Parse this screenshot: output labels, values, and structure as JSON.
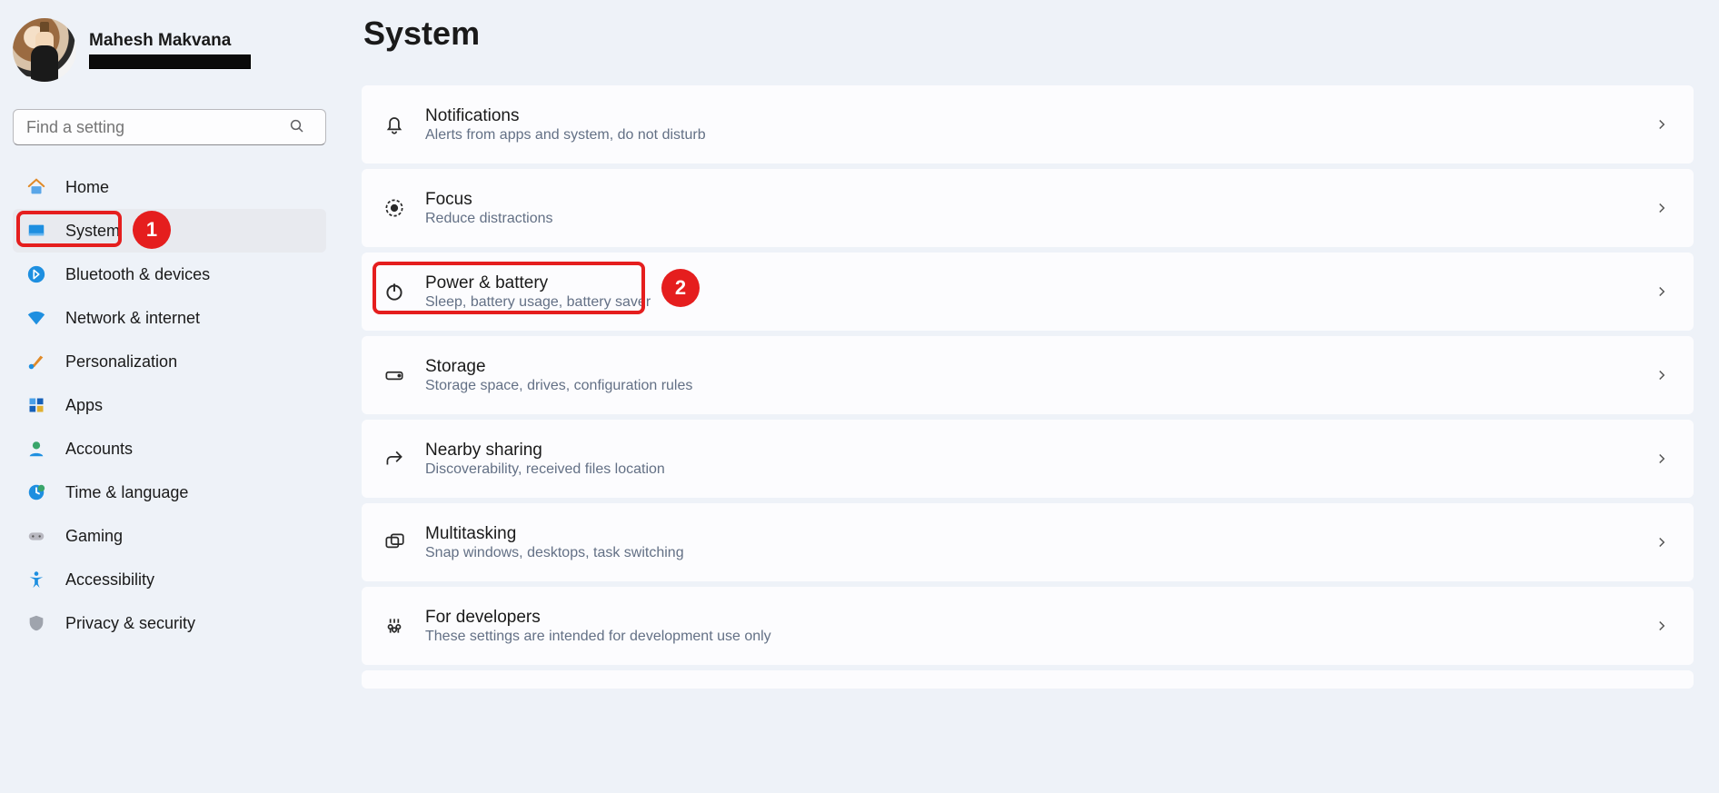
{
  "profile": {
    "name": "Mahesh Makvana"
  },
  "search": {
    "placeholder": "Find a setting"
  },
  "nav": {
    "items": [
      {
        "label": "Home"
      },
      {
        "label": "System"
      },
      {
        "label": "Bluetooth & devices"
      },
      {
        "label": "Network & internet"
      },
      {
        "label": "Personalization"
      },
      {
        "label": "Apps"
      },
      {
        "label": "Accounts"
      },
      {
        "label": "Time & language"
      },
      {
        "label": "Gaming"
      },
      {
        "label": "Accessibility"
      },
      {
        "label": "Privacy & security"
      }
    ]
  },
  "page": {
    "title": "System"
  },
  "cards": [
    {
      "title": "Notifications",
      "sub": "Alerts from apps and system, do not disturb"
    },
    {
      "title": "Focus",
      "sub": "Reduce distractions"
    },
    {
      "title": "Power & battery",
      "sub": "Sleep, battery usage, battery saver"
    },
    {
      "title": "Storage",
      "sub": "Storage space, drives, configuration rules"
    },
    {
      "title": "Nearby sharing",
      "sub": "Discoverability, received files location"
    },
    {
      "title": "Multitasking",
      "sub": "Snap windows, desktops, task switching"
    },
    {
      "title": "For developers",
      "sub": "These settings are intended for development use only"
    }
  ],
  "annotations": {
    "callout1": "1",
    "callout2": "2"
  }
}
